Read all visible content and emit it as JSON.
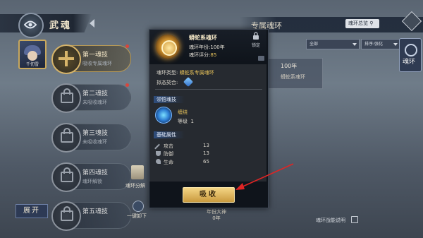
{
  "header": {
    "title": "武魂",
    "right_title": "专属魂环",
    "ring_overview": "魂环总览"
  },
  "avatar": {
    "caption": "千仞雪"
  },
  "skills": [
    {
      "name": "第一魂技",
      "sub": "吸收专属魂环",
      "state": "active"
    },
    {
      "name": "第二魂技",
      "sub": "未吸收魂环",
      "state": "locked"
    },
    {
      "name": "第三魂技",
      "sub": "未吸收魂环",
      "state": "locked"
    },
    {
      "name": "第四魂技",
      "sub": "魂环解锁",
      "state": "locked"
    },
    {
      "name": "第五魂技",
      "sub": "",
      "state": "locked"
    }
  ],
  "expand_label": "展开",
  "side": {
    "item1": "魂环分解",
    "item2": "一键卸下"
  },
  "filters": {
    "all": "全部",
    "sort": "排序:强化"
  },
  "ring_tab": "魂环",
  "ring_card": {
    "year": "100年",
    "name": "蟒蛇系魂环"
  },
  "bottom_info": "魂环战能说明",
  "mid_bottom": {
    "line1": "年份大神",
    "line2": "0年"
  },
  "popup": {
    "name": "蟒蛇系魂环",
    "year_label": "魂环年份:",
    "year_value": "100年",
    "score_label": "魂环评分:",
    "score_value": "85",
    "lock_label": "锁定",
    "type_label": "魂环类型:",
    "type_value": "蟒蛇系专属魂环",
    "fit_label": "拟态契合:",
    "section_skill": "领悟魂技",
    "skill_name": "缠绕",
    "skill_level_label": "等级",
    "skill_level": "1",
    "section_base": "基础属性",
    "stats": [
      {
        "label": "攻击",
        "value": "13"
      },
      {
        "label": "防御",
        "value": "13"
      },
      {
        "label": "生命",
        "value": "65"
      }
    ],
    "absorb": "吸收"
  },
  "colors": {
    "gold": "#e8c35a",
    "accent_blue": "#2e4d7c",
    "annotation_red": "#e02424"
  }
}
